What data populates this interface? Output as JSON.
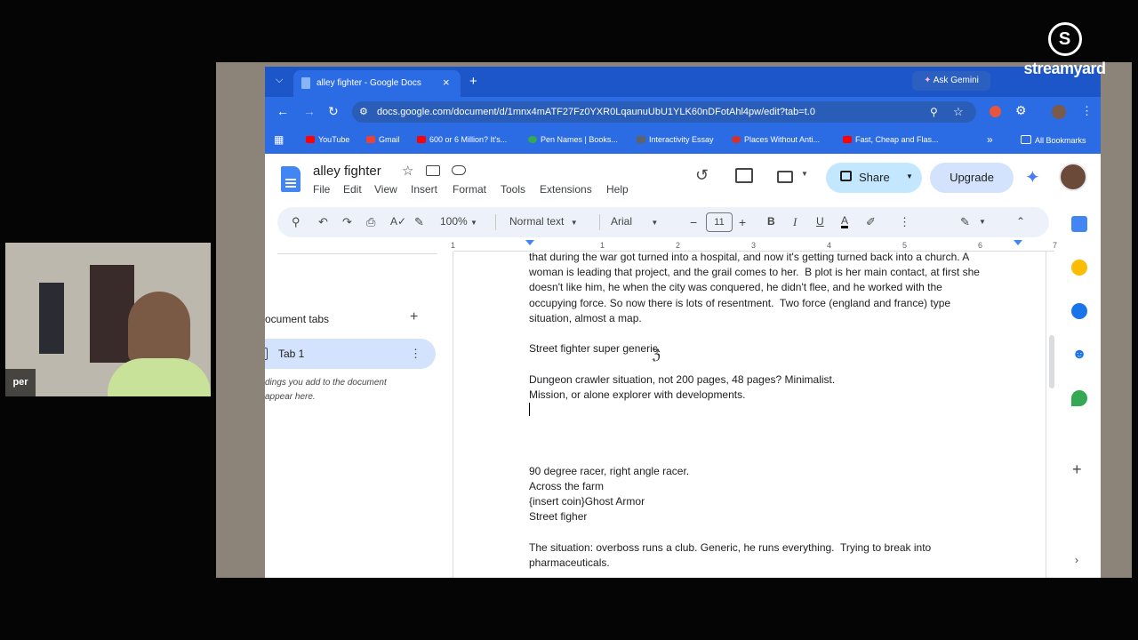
{
  "stream": {
    "brand": "streamyard",
    "guest_name": "per"
  },
  "browser": {
    "tab_title": "alley fighter - Google Docs",
    "ask_gemini": "Ask Gemini",
    "url": "docs.google.com/document/d/1mnx4mATF27Fz0YXR0LqaunuUbU1YLK60nDFotAhl4pw/edit?tab=t.0",
    "bookmarks": [
      {
        "label": "YouTube",
        "color": "#ff0000"
      },
      {
        "label": "Gmail",
        "color": "#ea4335"
      },
      {
        "label": "600 or 6 Million? It's...",
        "color": "#ff0000"
      },
      {
        "label": "Pen Names | Books...",
        "color": "#34a853"
      },
      {
        "label": "Interactivity Essay",
        "color": "#5f6368"
      },
      {
        "label": "Places Without Anti...",
        "color": "#d93025"
      },
      {
        "label": "Fast, Cheap and Flas...",
        "color": "#ff0000"
      }
    ],
    "all_bookmarks": "All Bookmarks"
  },
  "docs": {
    "title": "alley fighter",
    "menu": [
      "File",
      "Edit",
      "View",
      "Insert",
      "Format",
      "Tools",
      "Extensions",
      "Help"
    ],
    "share_label": "Share",
    "upgrade_label": "Upgrade",
    "toolbar": {
      "zoom": "100%",
      "style": "Normal text",
      "font": "Arial",
      "font_size": "11"
    },
    "ruler_marks": [
      "1",
      "1",
      "2",
      "3",
      "4",
      "5",
      "6",
      "7"
    ],
    "left_panel": {
      "heading": "ocument tabs",
      "tab_name": "Tab 1",
      "hint_line1": "dings you add to the document",
      "hint_line2": "appear here."
    },
    "body": [
      "that during the war got turned into a hospital, and now it's getting turned back into a church. A",
      "woman is leading that project, and the grail comes to her.  B plot is her main contact, at first she",
      "doesn't like him, he when the city was conquered, he didn't flee, and he worked with the",
      "occupying force. So now there is lots of resentment.  Two force (england and france) type",
      "situation, almost a map.",
      "",
      "Street fighter super generic.",
      "",
      "Dungeon crawler situation, not 200 pages, 48 pages? Minimalist.",
      "Mission, or alone explorer with developments.",
      "",
      "",
      "",
      "",
      "90 degree racer, right angle racer.",
      "Across the farm",
      "{insert coin}Ghost Armor",
      "Street figher",
      "",
      "The situation: overboss runs a club. Generic, he runs everything.  Trying to break into",
      "pharmaceuticals."
    ]
  }
}
